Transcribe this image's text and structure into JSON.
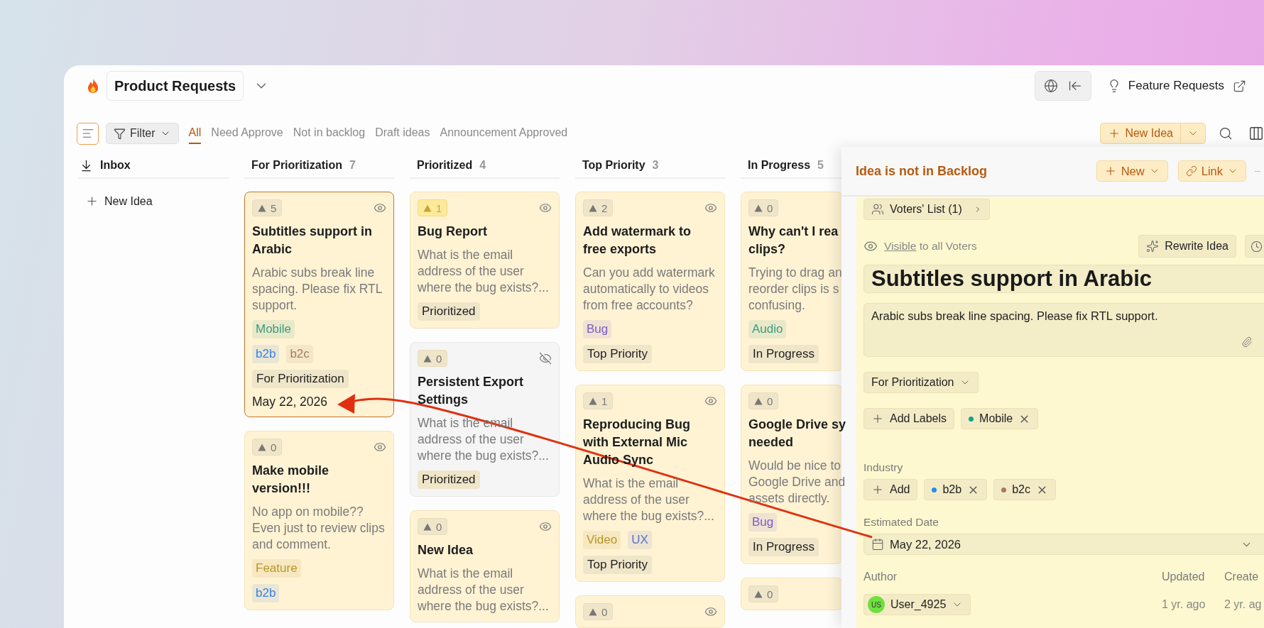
{
  "header": {
    "board_title": "Product Requests",
    "portal_link": "Feature Requests"
  },
  "toolbar": {
    "filter": "Filter",
    "views": [
      {
        "label": "All",
        "selected": true
      },
      {
        "label": "Need Approve",
        "selected": false
      },
      {
        "label": "Not in backlog",
        "selected": false
      },
      {
        "label": "Draft ideas",
        "selected": false
      },
      {
        "label": "Announcement Approved",
        "selected": false
      }
    ],
    "new_idea": "New Idea"
  },
  "inbox": {
    "title": "Inbox",
    "new_idea": "New Idea"
  },
  "columns": [
    {
      "title": "For Prioritization",
      "count": "7",
      "cards": [
        {
          "votes": "5",
          "voted": false,
          "visible": true,
          "selected": true,
          "title": "Subtitles support in Arabic",
          "description": "Arabic subs break line spacing. Please fix RTL support.",
          "labels": [
            {
              "text": "Mobile",
              "color": "#3a9a80"
            }
          ],
          "industries": [
            {
              "text": "b2b",
              "color": "#3b82e0"
            },
            {
              "text": "b2c",
              "color": "#a07e68"
            }
          ],
          "status": "For Prioritization",
          "date": "May 22, 2026"
        },
        {
          "votes": "0",
          "voted": false,
          "visible": true,
          "selected": false,
          "title": "Make mobile version!!!",
          "description": "No app on mobile?? Even just to review clips and comment.",
          "labels": [
            {
              "text": "Feature",
              "color": "#b8962a"
            }
          ],
          "industries": [
            {
              "text": "b2b",
              "color": "#3b82e0"
            }
          ]
        }
      ]
    },
    {
      "title": "Prioritized",
      "count": "4",
      "cards": [
        {
          "votes": "1",
          "voted": true,
          "visible": true,
          "selected": false,
          "title": "Bug Report",
          "description": "What is the email address of the user where the bug exists?...",
          "status": "Prioritized"
        },
        {
          "votes": "0",
          "voted": false,
          "visible": false,
          "selected": false,
          "title": "Persistent Export Settings",
          "description": "What is the email address of the user where the bug exists?...",
          "status": "Prioritized"
        },
        {
          "votes": "0",
          "voted": false,
          "visible": true,
          "selected": false,
          "title": "New Idea",
          "description": "What is the email address of the user where the bug exists?..."
        }
      ]
    },
    {
      "title": "Top Priority",
      "count": "3",
      "cards": [
        {
          "votes": "2",
          "voted": false,
          "visible": true,
          "selected": false,
          "title": "Add watermark to free exports",
          "description": "Can you add watermark automatically to videos from free accounts?",
          "labels": [
            {
              "text": "Bug",
              "color": "#7a5cc4"
            }
          ],
          "status": "Top Priority"
        },
        {
          "votes": "1",
          "voted": false,
          "visible": true,
          "selected": false,
          "title": "Reproducing Bug with External Mic Audio Sync",
          "description": "What is the email address of the user where the bug exists?...",
          "labels": [
            {
              "text": "Video",
              "color": "#b8962a"
            },
            {
              "text": "UX",
              "color": "#5b6fcc"
            }
          ],
          "status": "Top Priority"
        },
        {
          "votes": "0",
          "voted": false,
          "visible": true,
          "selected": false
        }
      ]
    },
    {
      "title": "In Progress",
      "count": "5",
      "cards": [
        {
          "votes": "0",
          "voted": false,
          "selected": false,
          "title": "Why can't I rea\nclips?",
          "description": "Trying to drag an\nreorder clips is s\nconfusing.",
          "labels": [
            {
              "text": "Audio",
              "color": "#3a9a80"
            }
          ],
          "status": "In Progress"
        },
        {
          "votes": "0",
          "voted": false,
          "selected": false,
          "title": "Google Drive sy\nneeded",
          "description": "Would be nice to\nGoogle Drive and\nassets directly.",
          "labels": [
            {
              "text": "Bug",
              "color": "#7a5cc4"
            }
          ],
          "status": "In Progress"
        },
        {
          "votes": "0",
          "voted": false,
          "selected": false
        }
      ]
    }
  ],
  "detail": {
    "banner": "Idea is not in Backlog",
    "new_button": "New",
    "link_button": "Link",
    "voters": "Voters' List (1)",
    "visibility_link": "Visible",
    "visibility_text": "to all Voters",
    "rewrite": "Rewrite Idea",
    "title": "Subtitles support in Arabic",
    "description": "Arabic subs break line spacing. Please fix RTL support.",
    "status": "For Prioritization",
    "add_labels": "Add Labels",
    "labels": [
      {
        "text": "Mobile",
        "color": "#16a08a"
      }
    ],
    "industry_label": "Industry",
    "add_industry": "Add",
    "industries": [
      {
        "text": "b2b",
        "color": "#1e90f0"
      },
      {
        "text": "b2c",
        "color": "#a87a5a"
      }
    ],
    "date_label": "Estimated Date",
    "date": "May 22, 2026",
    "author_label": "Author",
    "author": {
      "initials": "US",
      "name": "User_4925"
    },
    "updated_label": "Updated",
    "updated": "1 yr. ago",
    "created_label": "Create",
    "created": "2 yr. ag"
  }
}
